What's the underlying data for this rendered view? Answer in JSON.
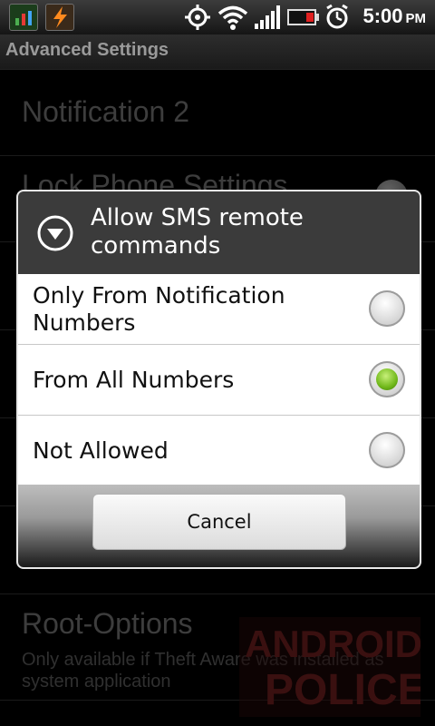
{
  "status_bar": {
    "time": "5:00",
    "ampm": "PM",
    "icons": [
      "gps-icon",
      "wifi-icon",
      "signal-icon",
      "battery-icon",
      "alarm-icon"
    ]
  },
  "title_bar": {
    "title": "Advanced Settings"
  },
  "settings": {
    "items": [
      {
        "title": "Notification 2"
      },
      {
        "title": "Lock Phone Settings"
      },
      {
        "title": "Root-Options",
        "subtitle": "Only available if Theft Aware was installed as system application"
      }
    ]
  },
  "watermark": {
    "line1": "ANDROID",
    "line2": "POLICE"
  },
  "dialog": {
    "title": "Allow SMS remote commands",
    "options": [
      {
        "label": "Only From Notification Numbers",
        "checked": false
      },
      {
        "label": "From All Numbers",
        "checked": true
      },
      {
        "label": "Not Allowed",
        "checked": false
      }
    ],
    "cancel_label": "Cancel"
  },
  "colors": {
    "radio_selected": "#70b81a",
    "dialog_header": "#3b3b3b"
  }
}
